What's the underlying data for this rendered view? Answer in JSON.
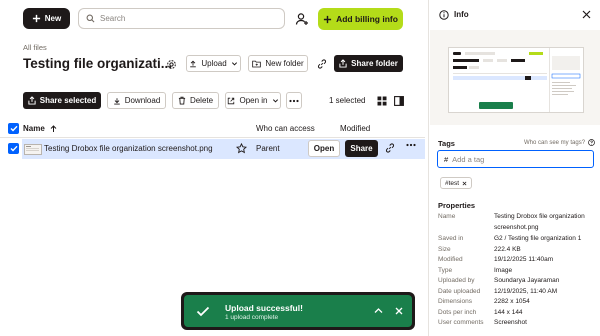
{
  "toolbar": {
    "new_label": "New",
    "search_placeholder": "Search",
    "billing_label": "Add billing info"
  },
  "breadcrumb": "All files",
  "page_title": "Testing file organizati...",
  "folder_actions": {
    "upload": "Upload",
    "new_folder": "New folder",
    "share_folder": "Share folder"
  },
  "selection_actions": {
    "share_selected": "Share selected",
    "download": "Download",
    "delete": "Delete",
    "open_in": "Open in",
    "count": "1 selected"
  },
  "table": {
    "columns": [
      "Name",
      "Who can access",
      "Modified"
    ],
    "rows": [
      {
        "name": "Testing Drobox file organization screenshot.png",
        "access": "Parent",
        "open_label": "Open",
        "share_label": "Share",
        "selected": true
      }
    ]
  },
  "toast": {
    "title": "Upload successful!",
    "subtitle": "1 upload complete"
  },
  "info_panel": {
    "title": "Info",
    "tags_label": "Tags",
    "tags_help": "Who can see my tags?",
    "tag_placeholder": "Add a tag",
    "tag_prefix": "#",
    "tags": [
      "#test"
    ],
    "properties_label": "Properties",
    "properties": [
      {
        "key": "Name",
        "value": "Testing Drobox file organization"
      },
      {
        "key": "",
        "value": "screenshot.png"
      },
      {
        "key": "Saved in",
        "value": "G2  /  Testing file organization 1"
      },
      {
        "key": "Size",
        "value": "222.4 KB"
      },
      {
        "key": "Modified",
        "value": "19/12/2025 11:40am"
      },
      {
        "key": "Type",
        "value": "Image"
      },
      {
        "key": "Uploaded by",
        "value": "Soundarya Jayaraman"
      },
      {
        "key": "Date uploaded",
        "value": "12/19/2025, 11:40 AM"
      },
      {
        "key": "Dimensions",
        "value": "2282 x 1054"
      },
      {
        "key": "Dots per inch",
        "value": "144 x 144"
      },
      {
        "key": "User comments",
        "value": "Screenshot"
      }
    ]
  },
  "colors": {
    "accent_blue": "#0061fe",
    "billing_green": "#b4dc19",
    "toast_green": "#1a7f4b",
    "ink": "#1e1919"
  }
}
